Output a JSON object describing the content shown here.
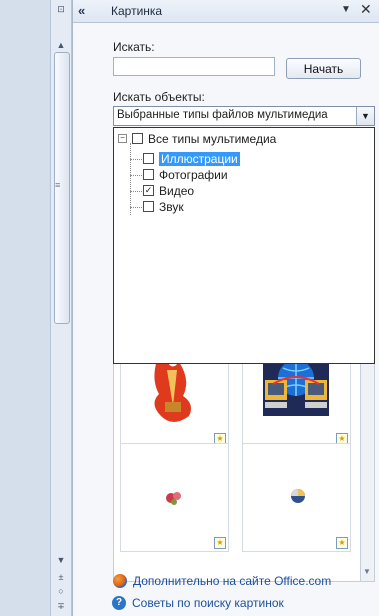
{
  "pane": {
    "title": "Картинка",
    "collapse_glyph": "«",
    "menu_glyph": "▼",
    "close_glyph": "✕"
  },
  "search": {
    "label": "Искать:",
    "value": "",
    "placeholder": "",
    "button_label": "Начать"
  },
  "object_types": {
    "label": "Искать объекты:",
    "selected": "Выбранные типы файлов мультимедиа",
    "tree": {
      "root": {
        "label": "Все типы мультимедиа",
        "checked": false
      },
      "items": [
        {
          "label": "Иллюстрации",
          "checked": false,
          "highlighted": true
        },
        {
          "label": "Фотографии",
          "checked": false
        },
        {
          "label": "Видео",
          "checked": true
        },
        {
          "label": "Звук",
          "checked": false
        }
      ]
    }
  },
  "results": {
    "thumbnails": [
      {
        "icon": "torch-clipart-icon"
      },
      {
        "icon": "computers-globe-clipart-icon"
      },
      {
        "icon": "small-flower-clipart-icon"
      },
      {
        "icon": "ball-clipart-icon"
      }
    ]
  },
  "footer": {
    "more_link": "Дополнительно на сайте Office.com",
    "tips_link": "Советы по поиску картинок"
  },
  "colors": {
    "accent": "#3399ff",
    "link": "#1d4f9e",
    "pane_bg": "#f5f7fb"
  }
}
